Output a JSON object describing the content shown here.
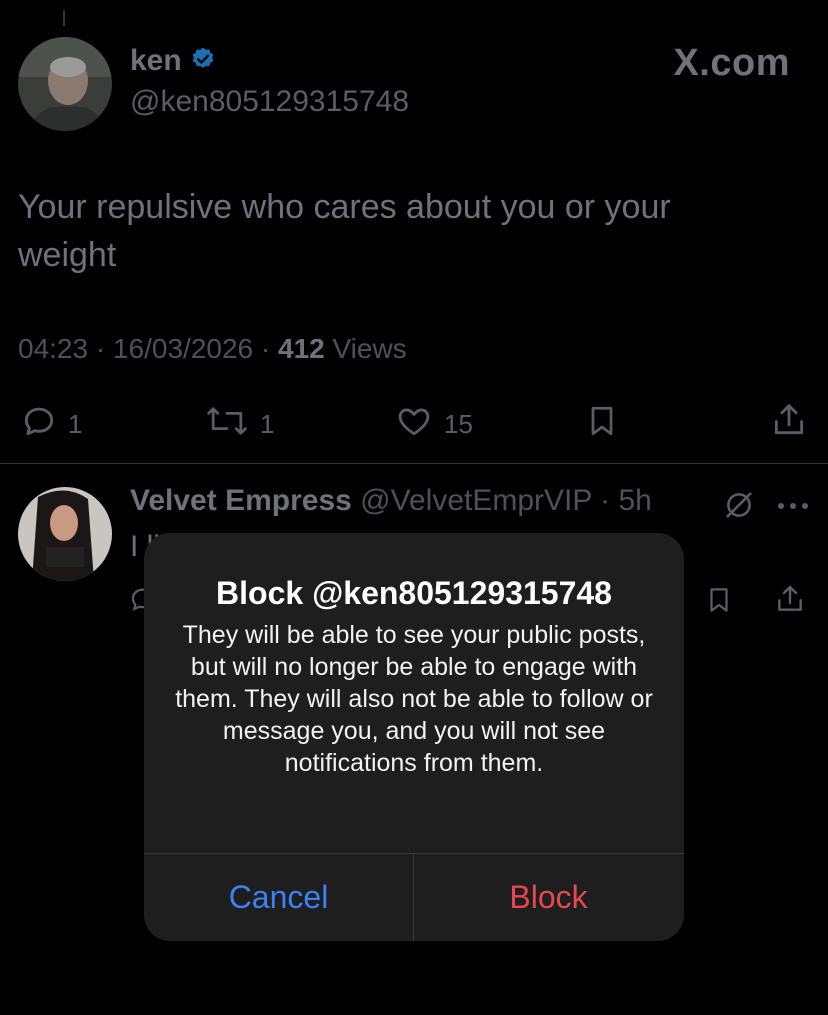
{
  "tweet": {
    "author_name": "ken",
    "author_handle": "@ken805129315748",
    "watermark": "X.com",
    "text": "Your repulsive who cares about you or your weight",
    "time": "04:23",
    "date": "16/03/2026",
    "views_count": "412",
    "views_label": "Views",
    "replies": "1",
    "reposts": "1",
    "likes": "15"
  },
  "reply": {
    "author_name": "Velvet Empress",
    "author_handle": "@VelvetEmprVIP",
    "time": "5h",
    "text_partial": "I li"
  },
  "dialog": {
    "title": "Block @ken805129315748",
    "body": "They will be able to see your public posts, but will no longer be able to engage with them. They will also not be able to follow or message you, and you will not see notifications from them.",
    "cancel_label": "Cancel",
    "confirm_label": "Block"
  },
  "colors": {
    "verified": "#1d9bf0",
    "cancel": "#3b82f6",
    "block": "#e5484d"
  },
  "icons": [
    "verified-badge-icon",
    "reply-icon",
    "repost-icon",
    "like-icon",
    "bookmark-icon",
    "share-icon",
    "grok-icon",
    "more-icon"
  ]
}
